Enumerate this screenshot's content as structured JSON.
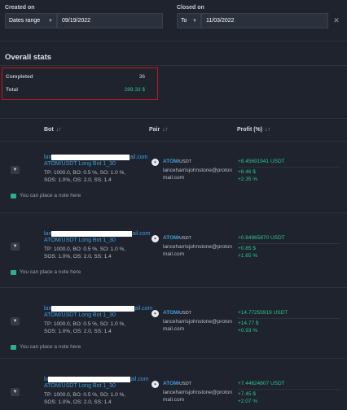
{
  "filters": {
    "created_label": "Created on",
    "created_mode": "Dates range",
    "created_value": "09/19/2022",
    "closed_label": "Closed on",
    "closed_mode": "To",
    "closed_value": "11/03/2022",
    "clear_icon": "close-icon"
  },
  "stats": {
    "title": "Overall stats",
    "completed_label": "Completed",
    "completed_value": "36",
    "total_label": "Total",
    "total_value": "289.33 $"
  },
  "table": {
    "columns": [
      {
        "label": "Bot",
        "sort": "↓↑"
      },
      {
        "label": "Pair",
        "sort": "↓↑"
      },
      {
        "label": "Profit (%)",
        "sort": "↓↑"
      }
    ],
    "rows": [
      {
        "email_prefix": "lan",
        "email_suffix": "ail.com",
        "name": "ATOM/USDT Long Bot 1_30",
        "params_1": "TP: 1000.0, BO: 0.5 %, SO: 1.0 %,",
        "params_2": "SOS: 1.0%, OS: 2.0, SS: 1.4",
        "note": "You can place a note here",
        "pair_base": "ATOM",
        "pair_quote": "/USDT",
        "owner": "lanceharrisjohnstone@protonmail.com",
        "profit_usdt": "+8.45691941 USDT",
        "profit_usd": "+8.46 $",
        "profit_pct": "+2.35 %"
      },
      {
        "email_prefix": "lan",
        "email_suffix": "ail.com",
        "name": "ATOM/USDT Long Bot 1_30",
        "params_1": "TP: 1000.0, BO: 0.5 %, SO: 1.0 %,",
        "params_2": "SOS: 1.0%, OS: 2.0, SS: 1.4",
        "note": "You can place a note here",
        "pair_base": "ATOM",
        "pair_quote": "/USDT",
        "owner": "lanceharrisjohnstone@protonmail.com",
        "profit_usdt": "+0.84965870 USDT",
        "profit_usd": "+0.85 $",
        "profit_pct": "+1.65 %"
      },
      {
        "email_prefix": "lan",
        "email_suffix": "ail.com",
        "name": "ATOM/USDT Long Bot 1_30",
        "params_1": "TP: 1000.0, BO: 0.5 %, SO: 1.0 %,",
        "params_2": "SOS: 1.0%, OS: 2.0, SS: 1.4",
        "note": "You can place a note here",
        "pair_base": "ATOM",
        "pair_quote": "/USDT",
        "owner": "lanceharrisjohnstone@protonmail.com",
        "profit_usdt": "+14.77255919 USDT",
        "profit_usd": "+14.77 $",
        "profit_pct": "+0.93 %"
      },
      {
        "email_prefix": "la",
        "email_suffix": "ail.com",
        "name": "ATOM/USDT Long Bot 1_30",
        "params_1": "TP: 1000.0, BO: 0.5 %, SO: 1.0 %,",
        "params_2": "SOS: 1.0%, OS: 2.0, SS: 1.4",
        "note": "",
        "pair_base": "ATOM",
        "pair_quote": "/USDT",
        "owner": "lanceharrisjohnstone@protonmail.com",
        "profit_usdt": "+7.44624807 USDT",
        "profit_usd": "+7.45 $",
        "profit_pct": "+2.07 %"
      }
    ]
  },
  "colors": {
    "background": "#1f232e",
    "accent": "#3b9ddd",
    "profit": "#2bc48a",
    "highlight": "#c21a1a"
  }
}
